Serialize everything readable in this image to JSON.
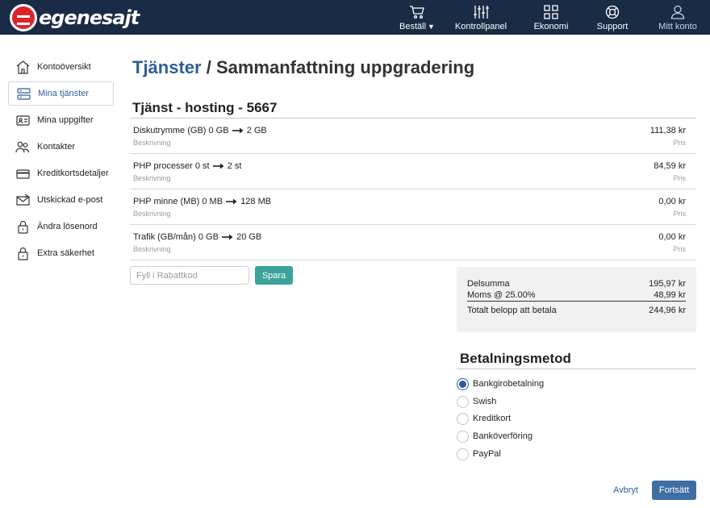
{
  "brand": {
    "logo_text": "egenesajt"
  },
  "topnav": [
    {
      "label": "Beställ",
      "icon": "cart-icon"
    },
    {
      "label": "Kontrollpanel",
      "icon": "sliders-icon"
    },
    {
      "label": "Ekonomi",
      "icon": "grid-icon"
    },
    {
      "label": "Support",
      "icon": "lifebuoy-icon"
    },
    {
      "label": "Mitt konto",
      "icon": "user-icon"
    }
  ],
  "sidebar": {
    "items": [
      {
        "label": "Kontoöversikt",
        "icon": "house-icon"
      },
      {
        "label": "Mina tjänster",
        "icon": "server-icon"
      },
      {
        "label": "Mina uppgifter",
        "icon": "id-card-icon"
      },
      {
        "label": "Kontakter",
        "icon": "contacts-icon"
      },
      {
        "label": "Kreditkortsdetaljer",
        "icon": "credit-card-icon"
      },
      {
        "label": "Utskickad e-post",
        "icon": "envelope-icon"
      },
      {
        "label": "Ändra lösenord",
        "icon": "lock-icon"
      },
      {
        "label": "Extra säkerhet",
        "icon": "lock-icon"
      }
    ]
  },
  "breadcrumb": {
    "link": "Tjänster",
    "separator": " / ",
    "current": "Sammanfattning uppgradering"
  },
  "service": {
    "title": "Tjänst - hosting - 5667",
    "rows": [
      {
        "name": "Diskutrymme (GB) 0 GB",
        "to": "2 GB",
        "desc": "Beskrivning",
        "price": "111,38 kr",
        "price_label": "Pris"
      },
      {
        "name": "PHP processer 0 st",
        "to": "2 st",
        "desc": "Beskrivning",
        "price": "84,59 kr",
        "price_label": "Pris"
      },
      {
        "name": "PHP minne (MB) 0 MB",
        "to": "128 MB",
        "desc": "Beskrivning",
        "price": "0,00 kr",
        "price_label": "Pris"
      },
      {
        "name": "Trafik (GB/mån) 0 GB",
        "to": "20 GB",
        "desc": "Beskrivning",
        "price": "0,00 kr",
        "price_label": "Pris"
      }
    ]
  },
  "discount": {
    "placeholder": "Fyll i Rabattkod",
    "value": "",
    "save_label": "Spara"
  },
  "summary": {
    "subtotal_label": "Delsumma",
    "subtotal": "195,97 kr",
    "vat_label": "Moms @ 25.00%",
    "vat": "48,99 kr",
    "total_label": "Totalt belopp att betala",
    "total": "244,96 kr"
  },
  "payment": {
    "title": "Betalningsmetod",
    "options": [
      "Bankgirobetalning",
      "Swish",
      "Kreditkort",
      "Banköverföring",
      "PayPal"
    ],
    "selected": "Bankgirobetalning"
  },
  "actions": {
    "cancel_label": "Avbryt",
    "continue_label": "Fortsätt"
  }
}
